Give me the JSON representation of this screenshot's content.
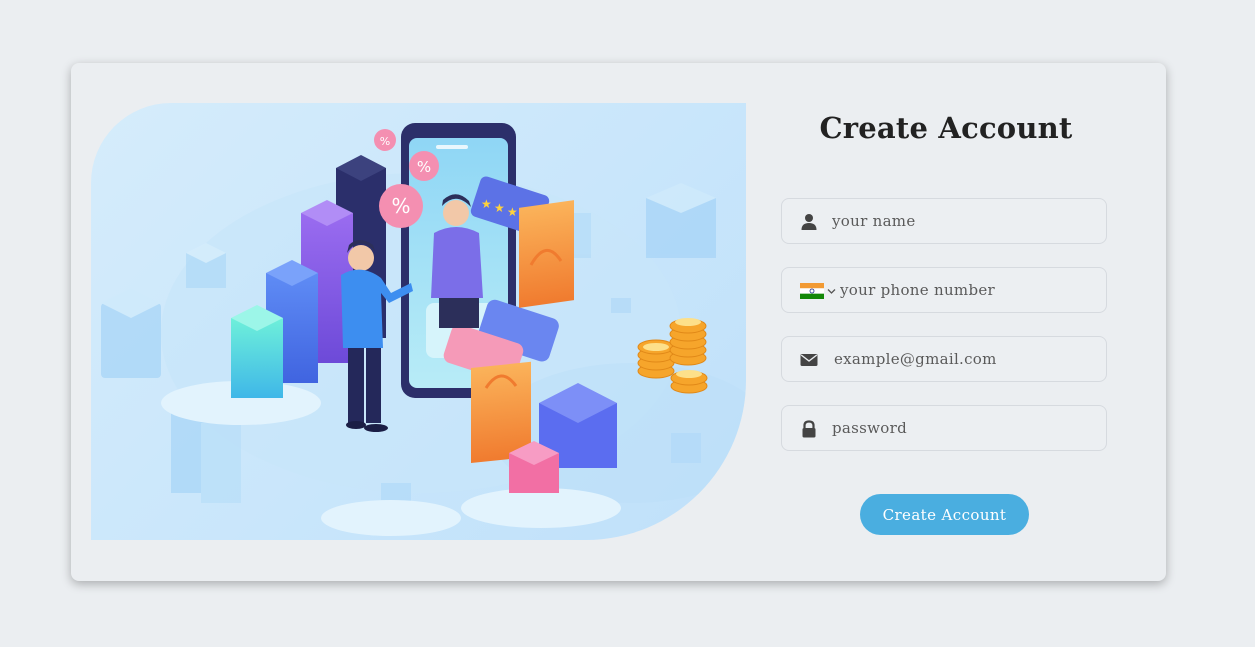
{
  "form": {
    "title": "Create Account",
    "name_placeholder": "your name",
    "phone_placeholder": "your phone number",
    "email_placeholder": "example@gmail.com",
    "password_placeholder": "password",
    "submit_label": "Create Account",
    "country_flag": "India"
  },
  "icons": {
    "name": "user-icon",
    "phone": "flag-india-icon",
    "country_dropdown": "chevron-down-icon",
    "email": "envelope-icon",
    "password": "lock-icon"
  },
  "colors": {
    "background": "#ebeef1",
    "button": "#4aaee0",
    "button_text": "#ffffff",
    "title": "#222222",
    "icon": "#444444"
  }
}
